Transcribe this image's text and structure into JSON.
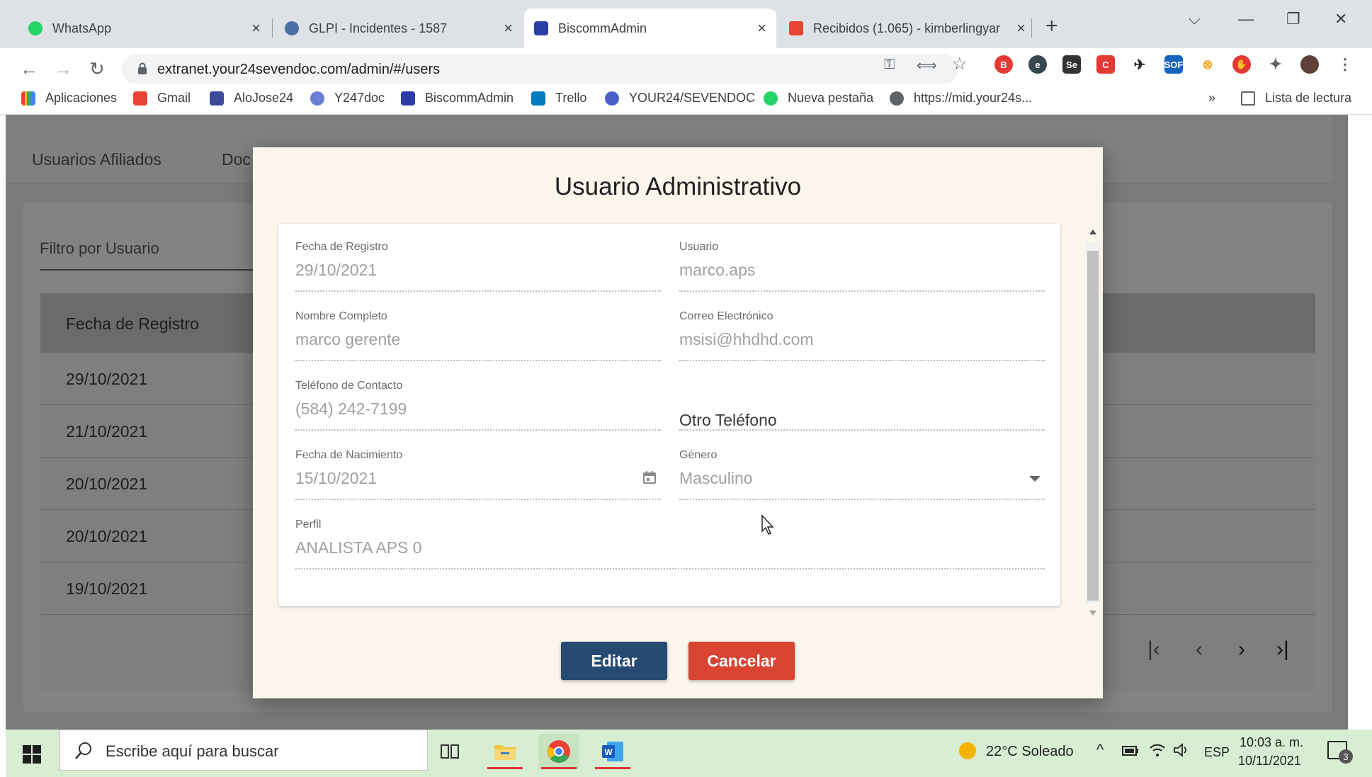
{
  "browser": {
    "tabs": [
      {
        "title": "WhatsApp",
        "color": "#25d366"
      },
      {
        "title": "GLPI - Incidentes - 1587",
        "color": "#4a6fa5"
      },
      {
        "title": "BiscommAdmin",
        "color": "#2c3ea8"
      },
      {
        "title": "Recibidos (1.065) - kimberlingyar",
        "color": "#ea4335"
      }
    ],
    "url": "extranet.your24sevendoc.com/admin/#/users",
    "bookmarks": [
      {
        "label": "Aplicaciones",
        "color": "#ea4335"
      },
      {
        "label": "Gmail",
        "color": "#ea4335"
      },
      {
        "label": "AloJose24",
        "color": "#3b4a9a"
      },
      {
        "label": "Y247doc",
        "color": "#6a7fd0"
      },
      {
        "label": "BiscommAdmin",
        "color": "#2c3ea8"
      },
      {
        "label": "Trello",
        "color": "#0079bf"
      },
      {
        "label": "YOUR24/SEVENDOC",
        "color": "#4a60c8"
      },
      {
        "label": "Nueva pestaña",
        "color": "#25d366"
      },
      {
        "label": "https://mid.your24s...",
        "color": "#5f6368"
      }
    ],
    "bookmarks_more": "»",
    "reading_list": "Lista de lectura"
  },
  "page": {
    "nav": [
      "Usuarios Afiliados",
      "Doc"
    ],
    "filter_label": "Filtro por Usuario",
    "table_header": "Fecha de Registro",
    "rows": [
      "29/10/2021",
      "21/10/2021",
      "20/10/2021",
      "20/10/2021",
      "19/10/2021"
    ]
  },
  "modal": {
    "title": "Usuario Administrativo",
    "fields": {
      "fecha_registro": {
        "label": "Fecha de Registro",
        "value": "29/10/2021"
      },
      "usuario": {
        "label": "Usuario",
        "value": "marco.aps"
      },
      "nombre": {
        "label": "Nombre Completo",
        "value": "marco gerente"
      },
      "correo": {
        "label": "Correo Electrónico",
        "value": "msisi@hhdhd.com"
      },
      "telefono": {
        "label": "Teléfono de Contacto",
        "value": "(584) 242-7199"
      },
      "otro_telefono": {
        "placeholder": "Otro Teléfono"
      },
      "nacimiento": {
        "label": "Fecha de Nacimiento",
        "value": "15/10/2021"
      },
      "genero": {
        "label": "Género",
        "value": "Masculino"
      },
      "perfil": {
        "label": "Perfil",
        "value": "ANALISTA APS 0"
      }
    },
    "edit_label": "Editar",
    "cancel_label": "Cancelar",
    "edit_color": "#264a72",
    "cancel_color": "#d84332"
  },
  "taskbar": {
    "search_placeholder": "Escribe aquí para buscar",
    "weather": "22°C  Soleado",
    "language": "ESP",
    "time": "10:03 a. m.",
    "date": "10/11/2021",
    "notifications": "3"
  }
}
